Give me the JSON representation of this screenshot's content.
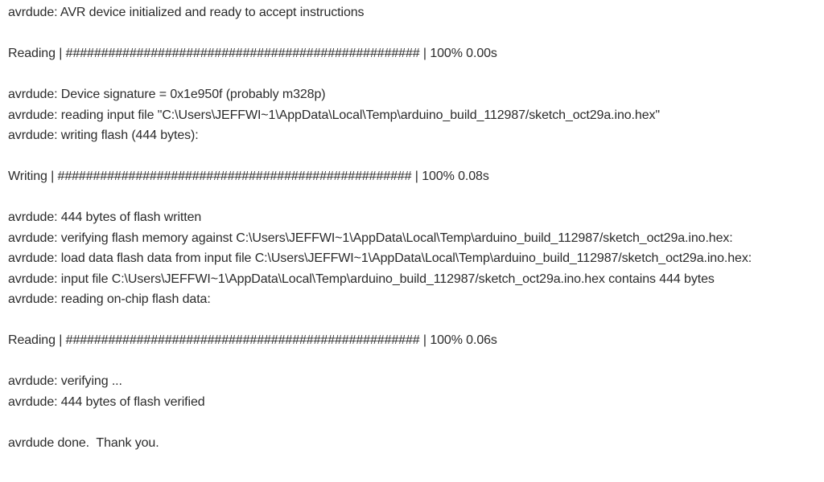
{
  "console": {
    "lines": [
      "avrdude: AVR device initialized and ready to accept instructions",
      "",
      "Reading | ################################################## | 100% 0.00s",
      "",
      "avrdude: Device signature = 0x1e950f (probably m328p)",
      "avrdude: reading input file \"C:\\Users\\JEFFWI~1\\AppData\\Local\\Temp\\arduino_build_112987/sketch_oct29a.ino.hex\"",
      "avrdude: writing flash (444 bytes):",
      "",
      "Writing | ################################################## | 100% 0.08s",
      "",
      "avrdude: 444 bytes of flash written",
      "avrdude: verifying flash memory against C:\\Users\\JEFFWI~1\\AppData\\Local\\Temp\\arduino_build_112987/sketch_oct29a.ino.hex:",
      "avrdude: load data flash data from input file C:\\Users\\JEFFWI~1\\AppData\\Local\\Temp\\arduino_build_112987/sketch_oct29a.ino.hex:",
      "avrdude: input file C:\\Users\\JEFFWI~1\\AppData\\Local\\Temp\\arduino_build_112987/sketch_oct29a.ino.hex contains 444 bytes",
      "avrdude: reading on-chip flash data:",
      "",
      "Reading | ################################################## | 100% 0.06s",
      "",
      "avrdude: verifying ...",
      "avrdude: 444 bytes of flash verified",
      "",
      "avrdude done.  Thank you."
    ]
  }
}
